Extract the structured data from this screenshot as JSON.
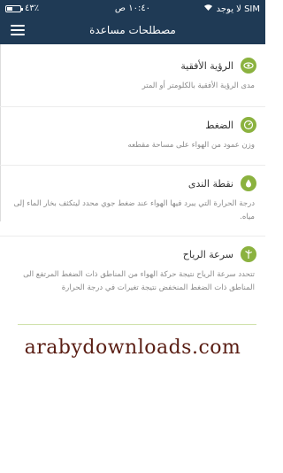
{
  "status": {
    "carrier": "لا يوجد SIM",
    "time": "١٠:٤٠ ص",
    "battery": "٤٣٪",
    "battery_level": 0.43
  },
  "header": {
    "title": "مصطلحات مساعدة"
  },
  "items": [
    {
      "title": "الرؤية الأفقية",
      "icon": "eye-icon",
      "description": "مدى الرؤية الأفقية بالكلومتر أو المتر"
    },
    {
      "title": "الضغط",
      "icon": "gauge-icon",
      "description": "وزن عمود من الهواء على مساحة مقطعه"
    },
    {
      "title": "نقطة الندى",
      "icon": "water-drop-icon",
      "description": "درجة الحرارة التي يبرد فيها الهواء عند ضغط جوي محدد ليتكثف بخار الماء إلى مياه."
    },
    {
      "title": "سرعة الرياح",
      "icon": "wind-turbine-icon",
      "description": "تتحدد سرعة الرياح نتيجة حركة الهواء من المناطق ذات الضغط المرتفع الى المناطق ذات الضغط المنخفض نتيجة تغيرات في درجة الحرارة"
    }
  ],
  "watermark": "arabydownloads.com",
  "colors": {
    "header_bg": "#1f3a55",
    "icon_bg": "#8bb23f"
  }
}
